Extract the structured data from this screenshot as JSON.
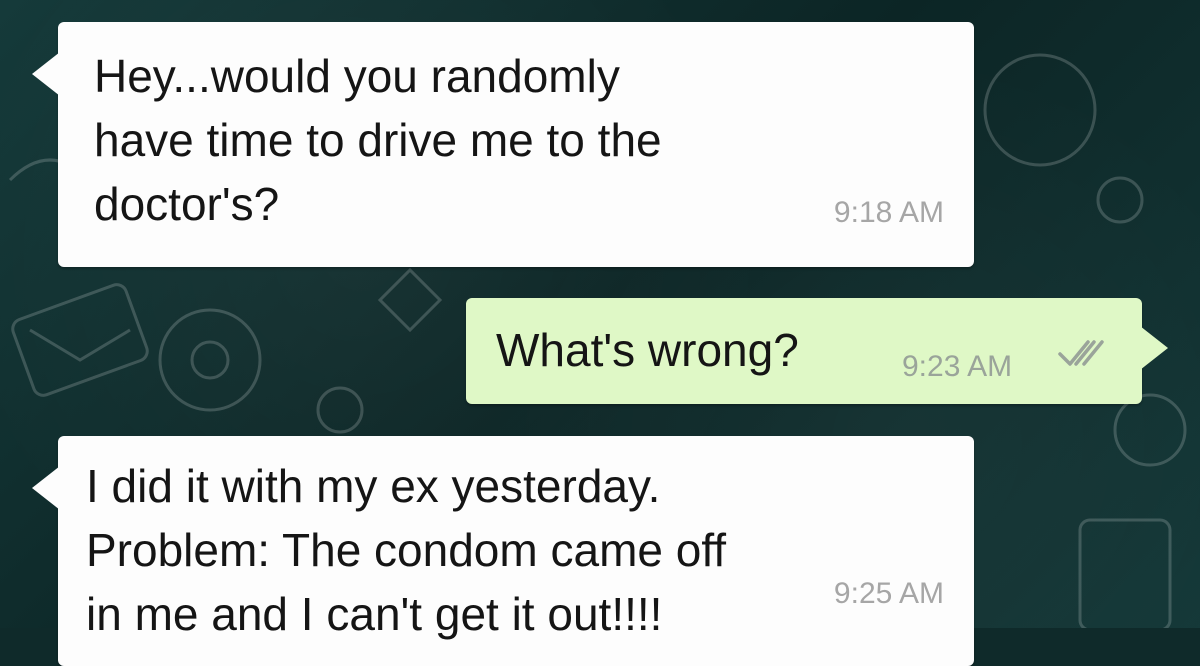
{
  "messages": [
    {
      "direction": "incoming",
      "text": "Hey...would you randomly\nhave time to drive me to the\ndoctor's?",
      "time": "9:18 AM"
    },
    {
      "direction": "outgoing",
      "text": "What's wrong?",
      "time": "9:23 AM",
      "status_icon": "double-check-icon"
    },
    {
      "direction": "incoming",
      "text": "I did it with my ex yesterday.\nProblem: The condom came off\nin me and I can't get it out!!!!",
      "time": "9:25 AM"
    }
  ],
  "colors": {
    "incoming_bubble": "#fdfdfd",
    "outgoing_bubble": "#dff8c6",
    "background": "#0f2a2a"
  }
}
